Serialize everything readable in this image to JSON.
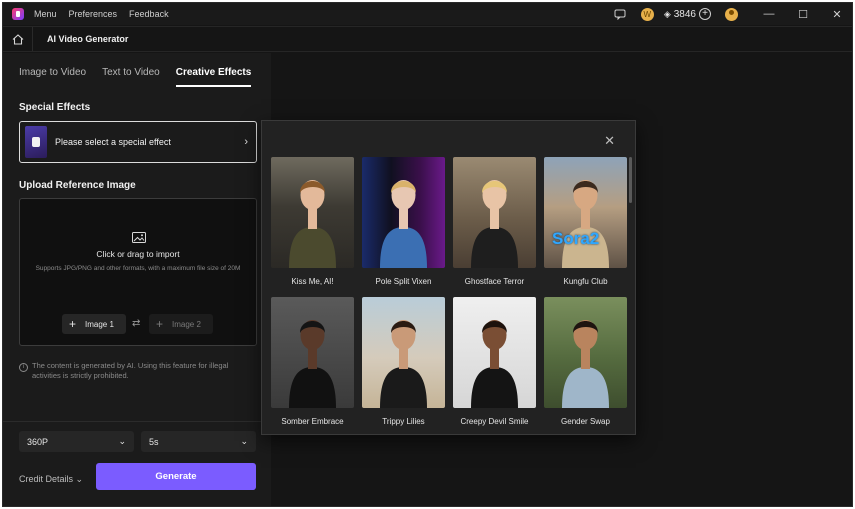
{
  "titlebar": {
    "menu_items": [
      "Menu",
      "Preferences",
      "Feedback"
    ],
    "credits": "3846",
    "icons": [
      "app-logo",
      "chat-icon",
      "coin-icon",
      "gem-icon",
      "add-icon",
      "avatar-icon",
      "minimize-icon",
      "maximize-icon",
      "close-icon"
    ]
  },
  "header": {
    "title": "AI Video Generator"
  },
  "tabs": [
    {
      "label": "Image to Video",
      "active": false
    },
    {
      "label": "Text to Video",
      "active": false
    },
    {
      "label": "Creative Effects",
      "active": true
    }
  ],
  "special_effects": {
    "heading": "Special Effects",
    "placeholder": "Please select a special effect"
  },
  "upload": {
    "heading": "Upload Reference Image",
    "title": "Click or drag to import",
    "hint": "Supports JPG/PNG and other formats, with a maximum file size of 20M",
    "slot1": "Image 1",
    "slot2": "Image 2"
  },
  "notice": "The content is generated by AI. Using this feature for illegal activities is strictly prohibited.",
  "resolution": "360P",
  "duration": "5s",
  "credit_details": "Credit Details",
  "generate": "Generate",
  "effects": [
    {
      "label": "Kiss Me, AI!",
      "scene": "street",
      "overlay": ""
    },
    {
      "label": "Pole Split Vixen",
      "scene": "neon",
      "overlay": ""
    },
    {
      "label": "Ghostface Terror",
      "scene": "city-day",
      "overlay": ""
    },
    {
      "label": "Kungfu Club",
      "scene": "street-wide",
      "overlay": "Sora2"
    },
    {
      "label": "Somber Embrace",
      "scene": "studio-dark",
      "overlay": ""
    },
    {
      "label": "Trippy Lilies",
      "scene": "beach",
      "overlay": ""
    },
    {
      "label": "Creepy Devil Smile",
      "scene": "studio-light",
      "overlay": ""
    },
    {
      "label": "Gender Swap",
      "scene": "park",
      "overlay": ""
    }
  ],
  "colors": {
    "accent": "#7b5cff",
    "background": "#151515",
    "panel": "#1b1b1b",
    "popup": "#222222"
  }
}
